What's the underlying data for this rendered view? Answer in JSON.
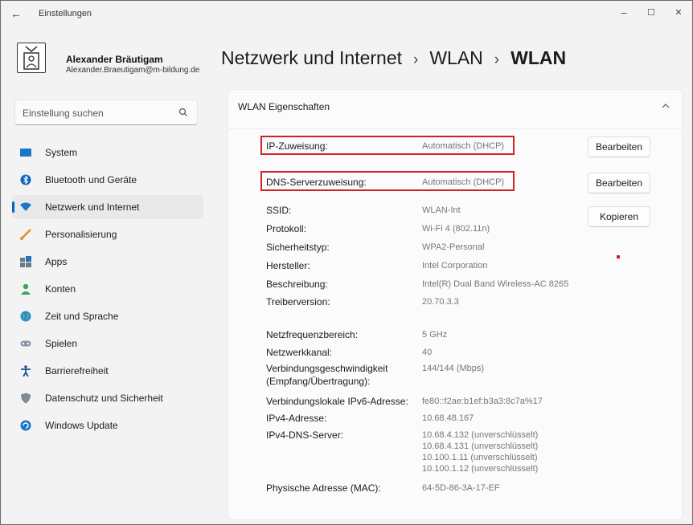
{
  "window": {
    "title": "Einstellungen",
    "controls": {
      "minimize": "–",
      "maximize": "☐",
      "close": "✕"
    }
  },
  "profile": {
    "name": "Alexander Bräutigam",
    "email": "Alexander.Braeutigam@m-bildung.de"
  },
  "search": {
    "placeholder": "Einstellung suchen"
  },
  "nav": {
    "items": [
      {
        "label": "System",
        "icon": "system-icon"
      },
      {
        "label": "Bluetooth und Geräte",
        "icon": "bluetooth-icon"
      },
      {
        "label": "Netzwerk und Internet",
        "icon": "wifi-icon",
        "active": true
      },
      {
        "label": "Personalisierung",
        "icon": "brush-icon"
      },
      {
        "label": "Apps",
        "icon": "apps-icon"
      },
      {
        "label": "Konten",
        "icon": "account-icon"
      },
      {
        "label": "Zeit und Sprache",
        "icon": "globe-clock-icon"
      },
      {
        "label": "Spielen",
        "icon": "gamepad-icon"
      },
      {
        "label": "Barrierefreiheit",
        "icon": "accessibility-icon"
      },
      {
        "label": "Datenschutz und Sicherheit",
        "icon": "shield-icon"
      },
      {
        "label": "Windows Update",
        "icon": "update-icon"
      }
    ]
  },
  "breadcrumb": {
    "part1": "Netzwerk und Internet",
    "sep": "›",
    "part2": "WLAN",
    "current": "WLAN"
  },
  "panel": {
    "title": "WLAN Eigenschaften",
    "ip_assignment": {
      "label": "IP-Zuweisung:",
      "value": "Automatisch (DHCP)",
      "button": "Bearbeiten"
    },
    "dns_assignment": {
      "label": "DNS-Serverzuweisung:",
      "value": "Automatisch (DHCP)",
      "button": "Bearbeiten"
    },
    "copy_button": "Kopieren",
    "props": [
      {
        "label": "SSID:",
        "value": "WLAN-Int"
      },
      {
        "label": "Protokoll:",
        "value": "Wi-Fi 4 (802.11n)"
      },
      {
        "label": "Sicherheitstyp:",
        "value": "WPA2-Personal"
      },
      {
        "label": "Hersteller:",
        "value": "Intel Corporation"
      },
      {
        "label": "Beschreibung:",
        "value": "Intel(R) Dual Band Wireless-AC 8265"
      },
      {
        "label": "Treiberversion:",
        "value": "20.70.3.3"
      },
      {
        "label": "Netzfrequenzbereich:",
        "value": "5 GHz"
      },
      {
        "label": "Netzwerkkanal:",
        "value": "40"
      },
      {
        "label": "Verbindungsgeschwindigkeit",
        "label2": "(Empfang/Übertragung):",
        "value": "144/144 (Mbps)"
      },
      {
        "label": "Verbindungslokale IPv6-Adresse:",
        "value": "fe80::f2ae:b1ef:b3a3:8c7a%17"
      },
      {
        "label": "IPv4-Adresse:",
        "value": "10.68.48.167"
      },
      {
        "label": "IPv4-DNS-Server:",
        "values": [
          "10.68.4.132 (unverschlüsselt)",
          "10.68.4.131 (unverschlüsselt)",
          "10.100.1.11 (unverschlüsselt)",
          "10.100.1.12 (unverschlüsselt)"
        ]
      },
      {
        "label": "Physische Adresse (MAC):",
        "value": "64-5D-86-3A-17-EF"
      }
    ]
  },
  "colors": {
    "accent": "#0067c0",
    "highlight": "#d31f26"
  }
}
